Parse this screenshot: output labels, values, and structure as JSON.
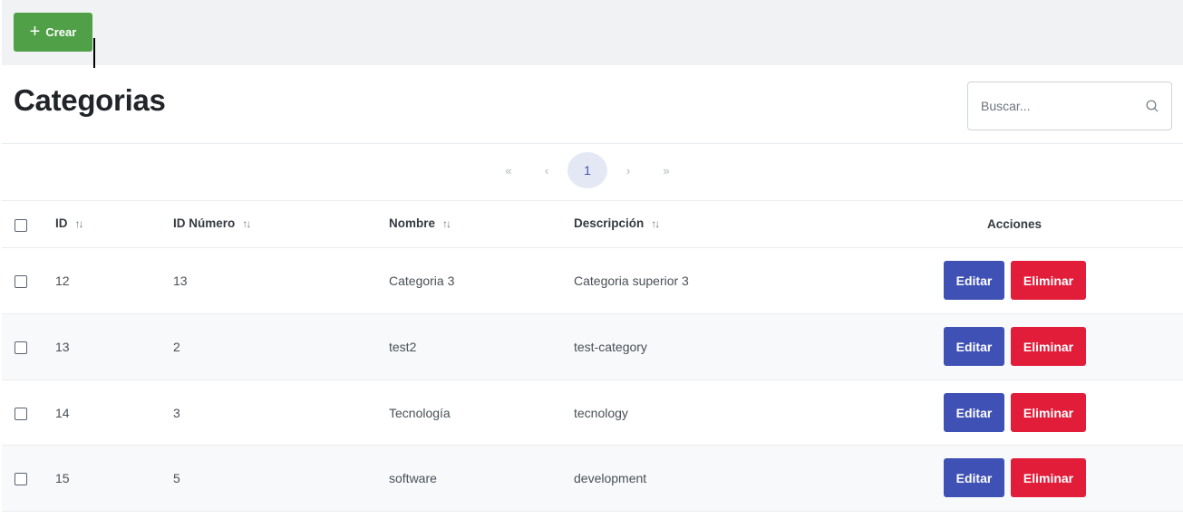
{
  "toolbar": {
    "create_label": "Crear",
    "create_icon": "plus-icon"
  },
  "page": {
    "title": "Categorias"
  },
  "search": {
    "placeholder": "Buscar...",
    "icon": "search-icon"
  },
  "paginator": {
    "first": "«",
    "prev": "‹",
    "current_page": "1",
    "next": "›",
    "last": "»"
  },
  "table": {
    "columns": {
      "id": "ID",
      "id_numero": "ID Número",
      "nombre": "Nombre",
      "descripcion": "Descripción",
      "acciones": "Acciones"
    },
    "sort_icon": "↑↓",
    "rows": [
      {
        "id": "12",
        "id_numero": "13",
        "nombre": "Categoria 3",
        "descripcion": "Categoria superior 3"
      },
      {
        "id": "13",
        "id_numero": "2",
        "nombre": "test2",
        "descripcion": "test-category"
      },
      {
        "id": "14",
        "id_numero": "3",
        "nombre": "Tecnología",
        "descripcion": "tecnology"
      },
      {
        "id": "15",
        "id_numero": "5",
        "nombre": "software",
        "descripcion": "development"
      }
    ],
    "edit_label": "Editar",
    "delete_label": "Eliminar"
  },
  "colors": {
    "create": "#4fa046",
    "edit": "#3f51b5",
    "delete": "#e11d3a",
    "page_active_bg": "#e4e8f4"
  }
}
